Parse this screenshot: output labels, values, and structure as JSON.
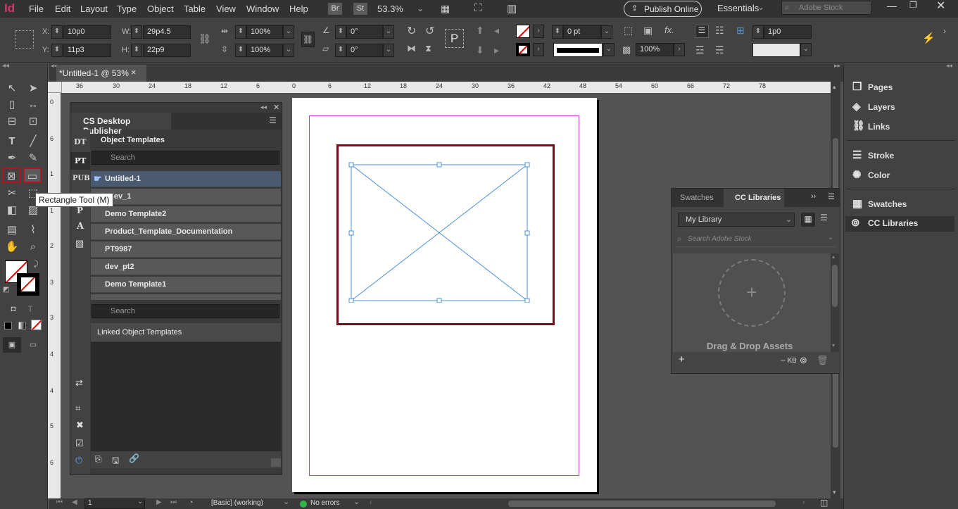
{
  "menubar": {
    "app_icon": "Id",
    "items": [
      "File",
      "Edit",
      "Layout",
      "Type",
      "Object",
      "Table",
      "View",
      "Window",
      "Help"
    ],
    "br": "Br",
    "st": "St",
    "zoom": "53.3%",
    "publish": "Publish Online",
    "workspace": "Essentials",
    "stock_placeholder": "Adobe Stock"
  },
  "control": {
    "x": "10p0",
    "y": "11p3",
    "w": "29p4.5",
    "h": "22p9",
    "scale_x": "100%",
    "scale_y": "100%",
    "rotate": "0°",
    "shear": "0°",
    "stroke_weight": "0 pt",
    "opacity": "100%",
    "gap": "1p0",
    "x_lbl": "X:",
    "y_lbl": "Y:",
    "w_lbl": "W:",
    "h_lbl": "H:"
  },
  "doc_tab": {
    "title": "*Untitled-1 @ 53%",
    "close": "×"
  },
  "ruler": {
    "h": [
      "36",
      "30",
      "24",
      "18",
      "12",
      "6",
      "0",
      "6",
      "12",
      "18",
      "24",
      "30",
      "36",
      "42",
      "48",
      "54",
      "60",
      "66",
      "72",
      "78"
    ],
    "v": [
      "0",
      "6",
      "1",
      "1",
      "2",
      "3",
      "3",
      "4",
      "4",
      "5",
      "6"
    ]
  },
  "tooltip": "Rectangle Tool (M)",
  "publisher": {
    "title": "CS Desktop Publisher",
    "tabs": [
      "DT",
      "PT",
      "PUB",
      "P",
      "A"
    ],
    "section": "Object Templates",
    "search1": "Search",
    "templates": [
      "Untitled-1",
      "_dev_1",
      "Demo Template2",
      "Product_Template_Documentation",
      "PT9987",
      "dev_pt2",
      "Demo Template1"
    ],
    "search2": "Search",
    "linked": "Linked Object Templates"
  },
  "dock": {
    "items": [
      "Pages",
      "Layers",
      "Links",
      "Stroke",
      "Color",
      "Swatches",
      "CC Libraries"
    ]
  },
  "cclib": {
    "tab_swatches": "Swatches",
    "tab_cc": "CC Libraries",
    "library": "My Library",
    "search_placeholder": "Search Adobe Stock",
    "drop": "Drag & Drop Assets",
    "kb": "-- KB"
  },
  "status": {
    "page": "1",
    "style": "[Basic] (working)",
    "errors": "No errors"
  },
  "colors": {
    "accent": "#7b0a1a",
    "frame_blue": "#4a90d9",
    "margin": "#c040c0",
    "selected_row": "#4a5a70"
  }
}
